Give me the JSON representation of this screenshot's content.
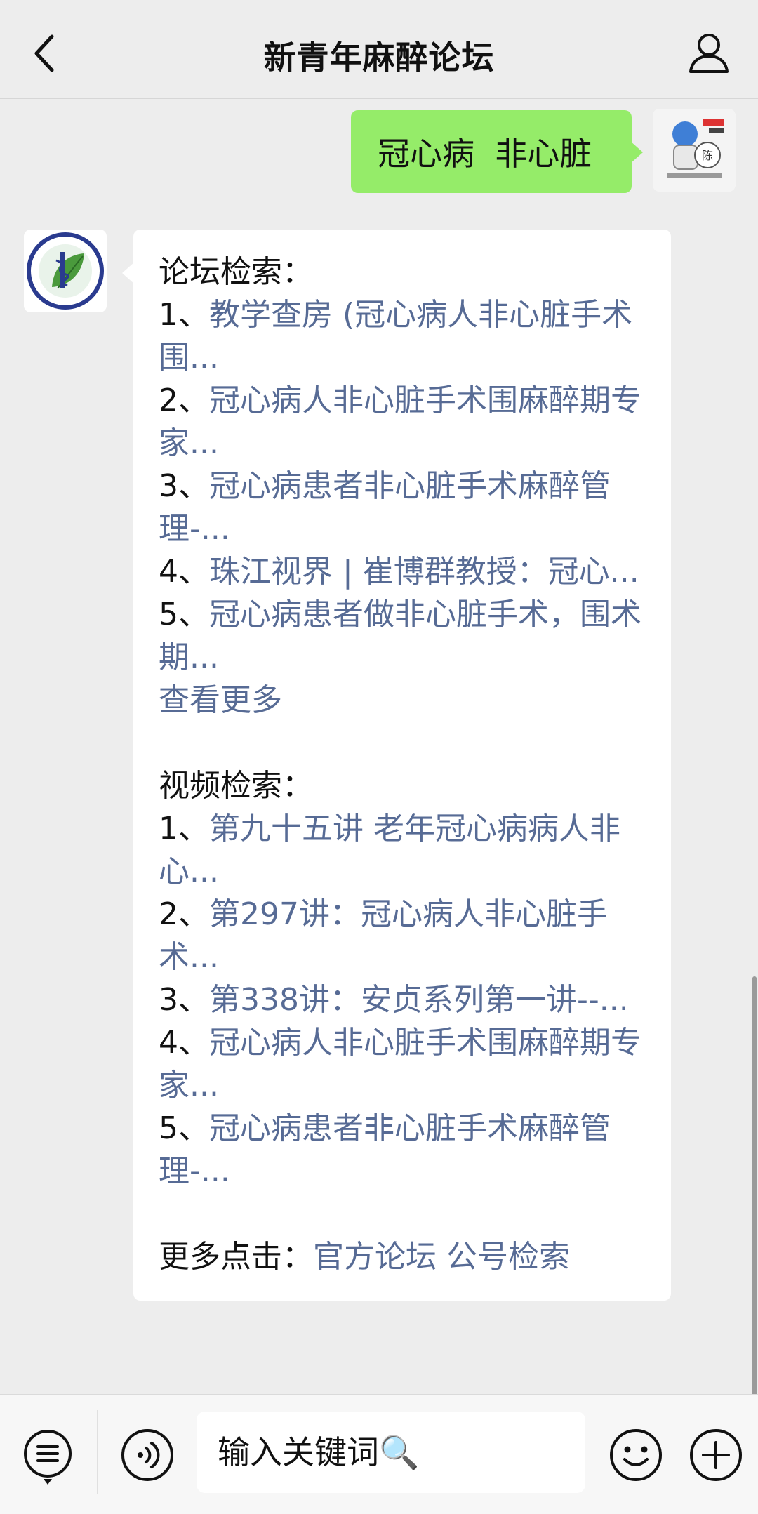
{
  "header": {
    "title": "新青年麻醉论坛"
  },
  "outgoing_message": {
    "text": "冠心病  非心脏"
  },
  "bot_avatar": {
    "label": "新青年麻醉论坛"
  },
  "reply": {
    "forum_title": "论坛检索：",
    "forum_items": [
      {
        "num": "1、",
        "text": "教学查房 (冠心病人非心脏手术围..."
      },
      {
        "num": "2、",
        "text": "冠心病人非心脏手术围麻醉期专家..."
      },
      {
        "num": "3、",
        "text": "冠心病患者非心脏手术麻醉管理-..."
      },
      {
        "num": "4、",
        "text": "珠江视界 | 崔博群教授：冠心..."
      },
      {
        "num": "5、",
        "text": "冠心病患者做非心脏手术，围术期..."
      }
    ],
    "forum_more": "查看更多",
    "video_title": "视频检索：",
    "video_items": [
      {
        "num": "1、",
        "text": "第九十五讲 老年冠心病病人非心..."
      },
      {
        "num": "2、",
        "text": "第297讲：冠心病人非心脏手术..."
      },
      {
        "num": "3、",
        "text": "第338讲：安贞系列第一讲--..."
      },
      {
        "num": "4、",
        "text": "冠心病人非心脏手术围麻醉期专家..."
      },
      {
        "num": "5、",
        "text": "冠心病患者非心脏手术麻醉管理-..."
      }
    ],
    "more_prefix": "更多点击：",
    "more_link_1": "官方论坛",
    "more_link_2": "公号检索"
  },
  "input": {
    "placeholder": "输入关键词🔍"
  },
  "colors": {
    "outgoing_bubble": "#95ec69",
    "link": "#576b95",
    "background": "#ededed"
  },
  "icons": [
    "back-icon",
    "profile-icon",
    "menu-list-icon",
    "voice-icon",
    "emoji-icon",
    "plus-icon"
  ]
}
